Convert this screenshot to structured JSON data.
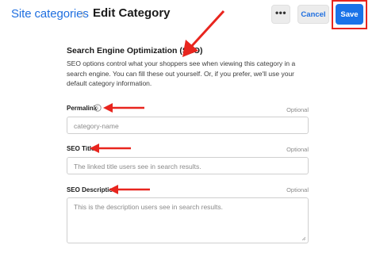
{
  "header": {
    "breadcrumb": "Site categories",
    "title": "Edit Category",
    "more_icon": "more-horizontal-icon",
    "more_label": "•••",
    "cancel_label": "Cancel",
    "save_label": "Save"
  },
  "seo": {
    "title": "Search Engine Optimization (SEO)",
    "description": "SEO options control what your shoppers see when viewing this category in a search engine. You can fill these out yourself. Or, if you prefer, we'll use your default category information.",
    "fields": {
      "permalink": {
        "label": "Permalink",
        "optional": "Optional",
        "placeholder": "category-name"
      },
      "seo_title": {
        "label": "SEO Title",
        "optional": "Optional",
        "placeholder": "The linked title users see in search results."
      },
      "seo_description": {
        "label": "SEO Description",
        "optional": "Optional",
        "placeholder": "This is the description users see in search results."
      }
    }
  },
  "colors": {
    "accent": "#1a73e8",
    "link": "#1f6fe0",
    "annotation": "#e8251e"
  }
}
